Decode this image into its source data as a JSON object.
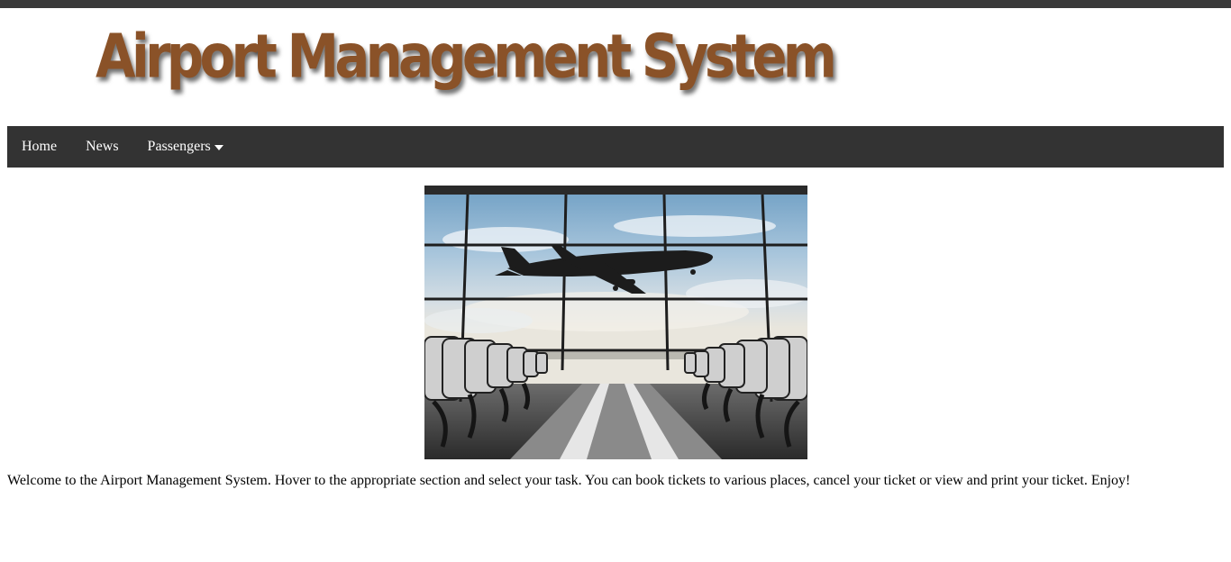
{
  "header": {
    "title": "Airport Management System"
  },
  "nav": {
    "items": [
      {
        "label": "Home"
      },
      {
        "label": "News"
      },
      {
        "label": "Passengers",
        "has_dropdown": true
      }
    ]
  },
  "hero": {
    "image": "airport-terminal-airplane-photo"
  },
  "main": {
    "welcome_text": "Welcome to the Airport Management System. Hover to the appropriate section and select your task. You can book tickets to various places, cancel your ticket or view and print your ticket. Enjoy!"
  },
  "colors": {
    "top_strip": "#3a3a3a",
    "title": "#8a5228",
    "navbar": "#333333",
    "nav_text": "#ffffff",
    "body_text": "#000000"
  }
}
